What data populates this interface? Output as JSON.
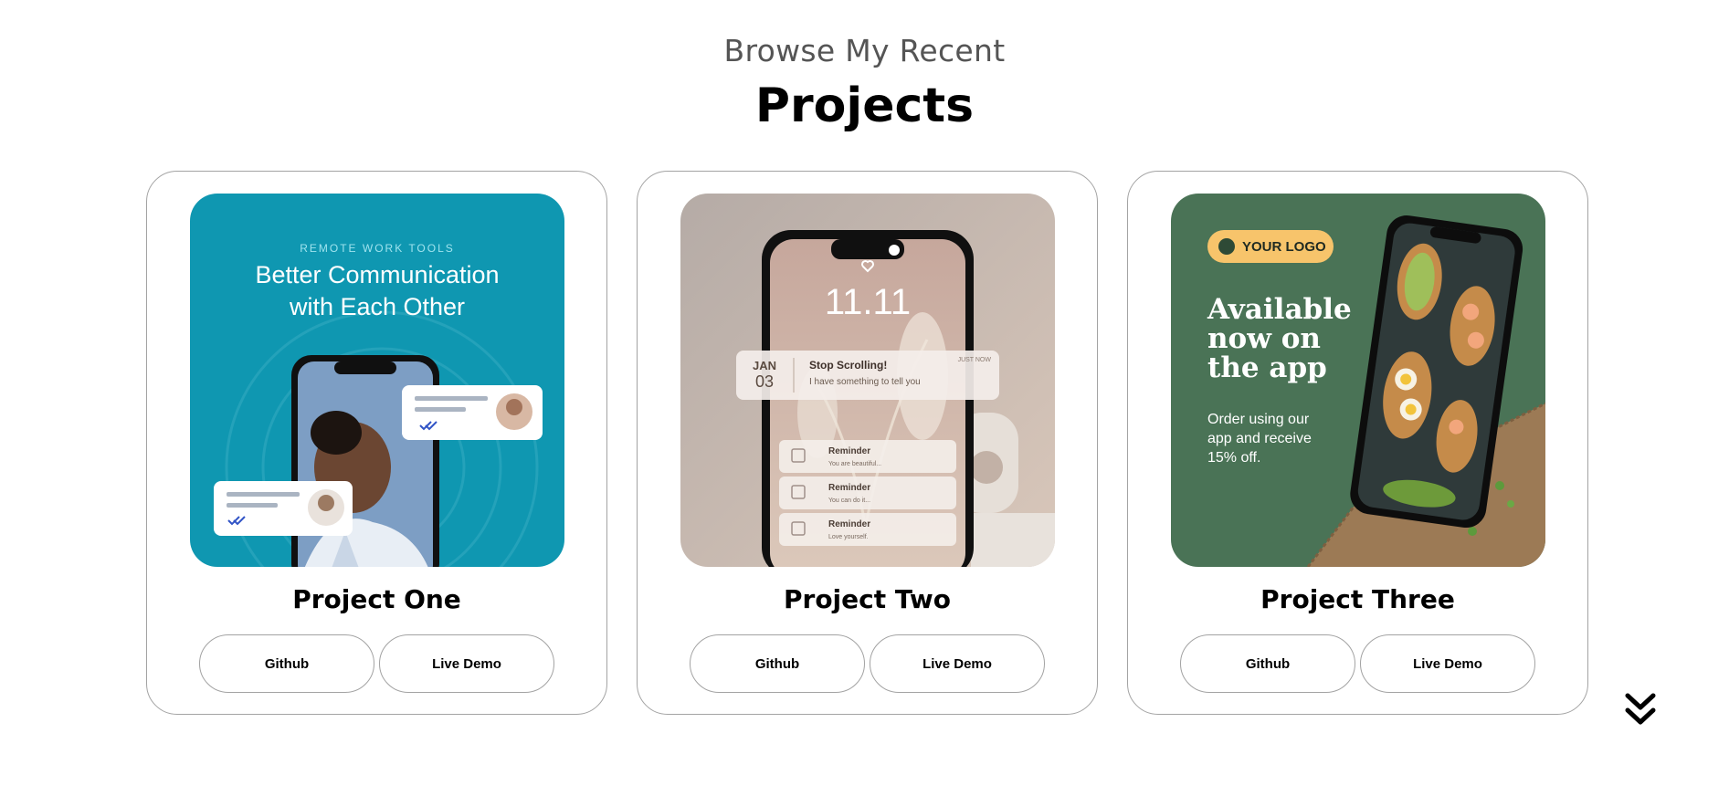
{
  "header": {
    "subtitle": "Browse My Recent",
    "title": "Projects"
  },
  "projects": [
    {
      "name": "Project One",
      "github_label": "Github",
      "demo_label": "Live Demo",
      "image": {
        "kicker": "REMOTE WORK TOOLS",
        "headline_line1": "Better Communication",
        "headline_line2": "with Each Other",
        "bg_color": "#0f97b1"
      }
    },
    {
      "name": "Project Two",
      "github_label": "Github",
      "demo_label": "Live Demo",
      "image": {
        "time": "11.11",
        "notif_month": "JAN",
        "notif_day": "03",
        "notif_title": "Stop Scrolling!",
        "notif_body": "I have something to tell you",
        "notif_time": "JUST NOW",
        "reminders": [
          {
            "title": "Reminder",
            "body": "You are beautiful..."
          },
          {
            "title": "Reminder",
            "body": "You can do it..."
          },
          {
            "title": "Reminder",
            "body": "Love yourself."
          }
        ],
        "bg_color": "#c9b5a9"
      }
    },
    {
      "name": "Project Three",
      "github_label": "Github",
      "demo_label": "Live Demo",
      "image": {
        "logo": "YOUR LOGO",
        "headline_line1": "Available",
        "headline_line2": "now on",
        "headline_line3": "the app",
        "body_line1": "Order using our",
        "body_line2": "app and receive",
        "body_line3": "15% off.",
        "bg_color": "#4a7356"
      }
    }
  ],
  "scroll_icon": "chevron-double-down-icon"
}
